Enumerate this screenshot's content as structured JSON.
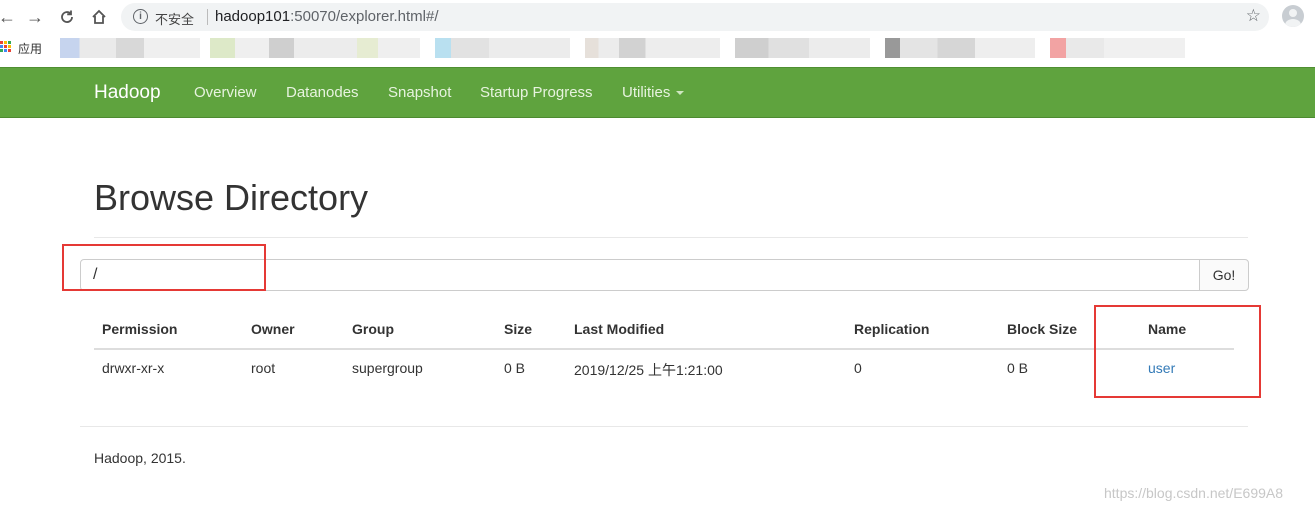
{
  "browser": {
    "security_label": "不安全",
    "url_host": "hadoop101",
    "url_rest": ":50070/explorer.html#/",
    "bookmarks_apps_label": "应用"
  },
  "navbar": {
    "brand": "Hadoop",
    "links": [
      "Overview",
      "Datanodes",
      "Snapshot",
      "Startup Progress",
      "Utilities"
    ]
  },
  "page": {
    "title": "Browse Directory",
    "path_value": "/",
    "go_label": "Go!"
  },
  "table": {
    "headers": [
      "Permission",
      "Owner",
      "Group",
      "Size",
      "Last Modified",
      "Replication",
      "Block Size",
      "Name"
    ],
    "rows": [
      [
        "drwxr-xr-x",
        "root",
        "supergroup",
        "0 B",
        "2019/12/25 上午1:21:00",
        "0",
        "0 B",
        "user"
      ]
    ]
  },
  "footer": {
    "text": "Hadoop, 2015."
  },
  "watermark": "https://blog.csdn.net/E699A8",
  "colors": {
    "navbar": "#5fa33e",
    "link": "#337ab7",
    "annotation": "#e53935"
  }
}
